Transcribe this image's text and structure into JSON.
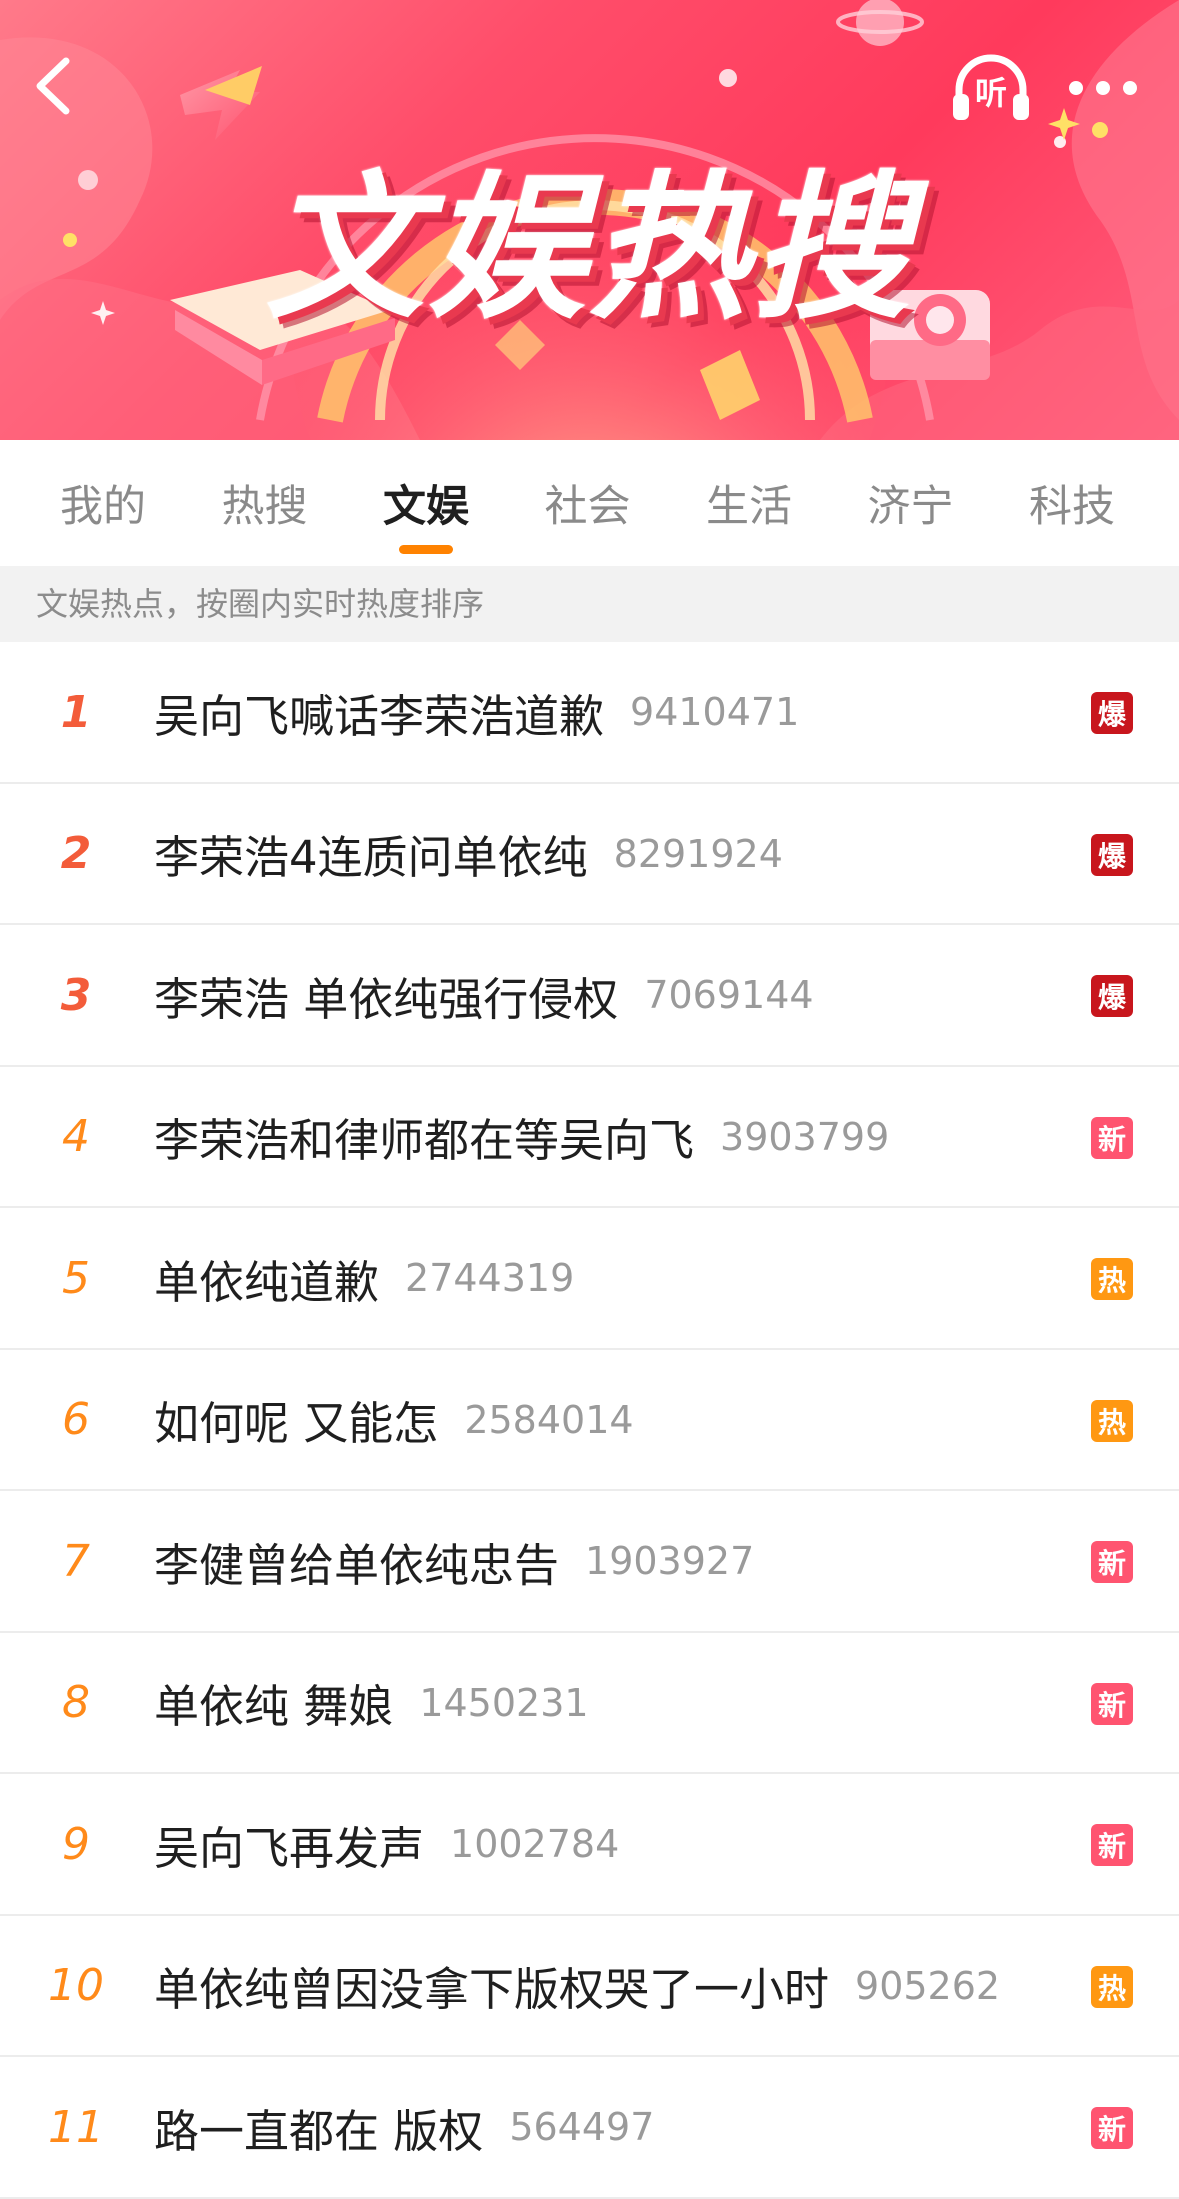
{
  "banner": {
    "title": "文娱热搜",
    "back_icon": "chevron-left-icon",
    "listen_icon": "headphones-icon",
    "listen_label": "听",
    "more_icon": "more-dots-icon"
  },
  "tabs": [
    {
      "label": "我的",
      "active": false
    },
    {
      "label": "热搜",
      "active": false
    },
    {
      "label": "文娱",
      "active": true
    },
    {
      "label": "社会",
      "active": false
    },
    {
      "label": "生活",
      "active": false
    },
    {
      "label": "济宁",
      "active": false
    },
    {
      "label": "科技",
      "active": false
    }
  ],
  "section_note": "文娱热点，按圈内实时热度排序",
  "colors": {
    "accent_underline": "#ff8200",
    "badge_bao": "#c8161d",
    "badge_xin": "#ff5470",
    "badge_re": "#ff9812",
    "rank_top": "#f35c3a",
    "rank_other": "#ff8a1a"
  },
  "items": [
    {
      "rank": "1",
      "title": "吴向飞喊话李荣浩道歉",
      "count": "9410471",
      "badge": "爆",
      "badge_type": "bao"
    },
    {
      "rank": "2",
      "title": "李荣浩4连质问单依纯",
      "count": "8291924",
      "badge": "爆",
      "badge_type": "bao"
    },
    {
      "rank": "3",
      "title": "李荣浩 单依纯强行侵权",
      "count": "7069144",
      "badge": "爆",
      "badge_type": "bao"
    },
    {
      "rank": "4",
      "title": "李荣浩和律师都在等吴向飞",
      "count": "3903799",
      "badge": "新",
      "badge_type": "xin"
    },
    {
      "rank": "5",
      "title": "单依纯道歉",
      "count": "2744319",
      "badge": "热",
      "badge_type": "re"
    },
    {
      "rank": "6",
      "title": "如何呢 又能怎",
      "count": "2584014",
      "badge": "热",
      "badge_type": "re"
    },
    {
      "rank": "7",
      "title": "李健曾给单依纯忠告",
      "count": "1903927",
      "badge": "新",
      "badge_type": "xin"
    },
    {
      "rank": "8",
      "title": "单依纯 舞娘",
      "count": "1450231",
      "badge": "新",
      "badge_type": "xin"
    },
    {
      "rank": "9",
      "title": "吴向飞再发声",
      "count": "1002784",
      "badge": "新",
      "badge_type": "xin"
    },
    {
      "rank": "10",
      "title": "单依纯曾因没拿下版权哭了一小时",
      "count": "905262",
      "badge": "热",
      "badge_type": "re"
    },
    {
      "rank": "11",
      "title": "路一直都在 版权",
      "count": "564497",
      "badge": "新",
      "badge_type": "xin"
    }
  ]
}
